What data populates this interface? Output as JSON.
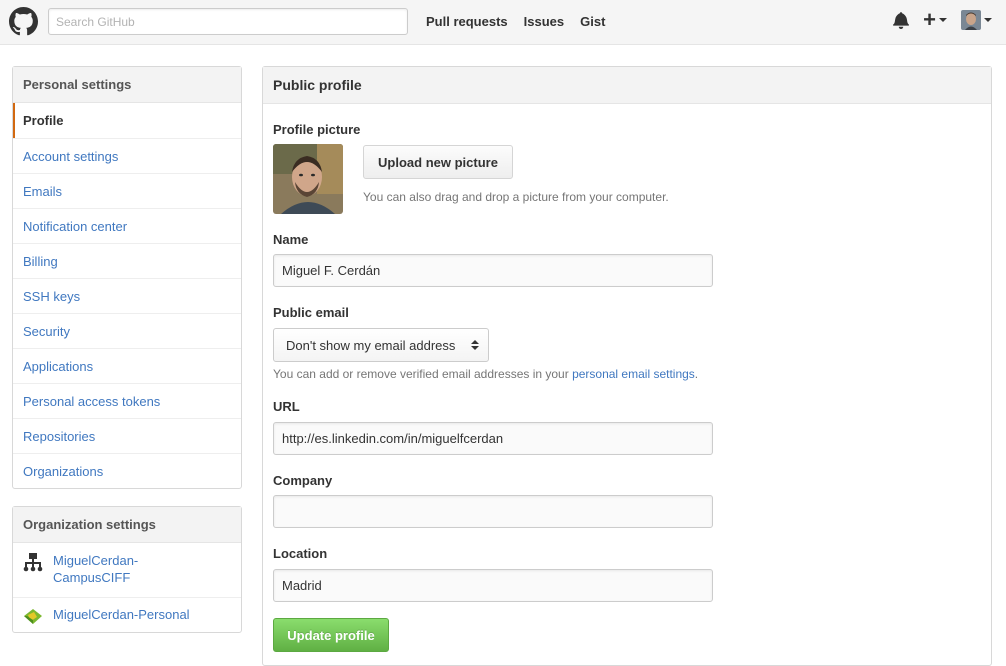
{
  "header": {
    "search_placeholder": "Search GitHub",
    "nav": [
      "Pull requests",
      "Issues",
      "Gist"
    ]
  },
  "sidebar": {
    "personal_heading": "Personal settings",
    "items": [
      {
        "label": "Profile",
        "selected": true
      },
      {
        "label": "Account settings"
      },
      {
        "label": "Emails"
      },
      {
        "label": "Notification center"
      },
      {
        "label": "Billing"
      },
      {
        "label": "SSH keys"
      },
      {
        "label": "Security"
      },
      {
        "label": "Applications"
      },
      {
        "label": "Personal access tokens"
      },
      {
        "label": "Repositories"
      },
      {
        "label": "Organizations"
      }
    ],
    "org_heading": "Organization settings",
    "orgs": [
      {
        "label": "MiguelCerdan-CampusCIFF",
        "icon": "org-tree-icon"
      },
      {
        "label": "MiguelCerdan-Personal",
        "icon": "org-avatar-icon"
      }
    ]
  },
  "main": {
    "heading": "Public profile",
    "picture_label": "Profile picture",
    "upload_label": "Upload new picture",
    "upload_note": "You can also drag and drop a picture from your computer.",
    "name_label": "Name",
    "name_value": "Miguel F. Cerdán",
    "email_label": "Public email",
    "email_selected": "Don't show my email address",
    "email_note_prefix": "You can add or remove verified email addresses in your",
    "email_note_link": "personal email settings",
    "email_note_suffix": ".",
    "url_label": "URL",
    "url_value": "http://es.linkedin.com/in/miguelfcerdan",
    "company_label": "Company",
    "company_value": "",
    "location_label": "Location",
    "location_value": "Madrid",
    "update_label": "Update profile"
  },
  "colors": {
    "link": "#4078c0",
    "selected_bar": "#d26911",
    "update_green": "#60b044"
  }
}
